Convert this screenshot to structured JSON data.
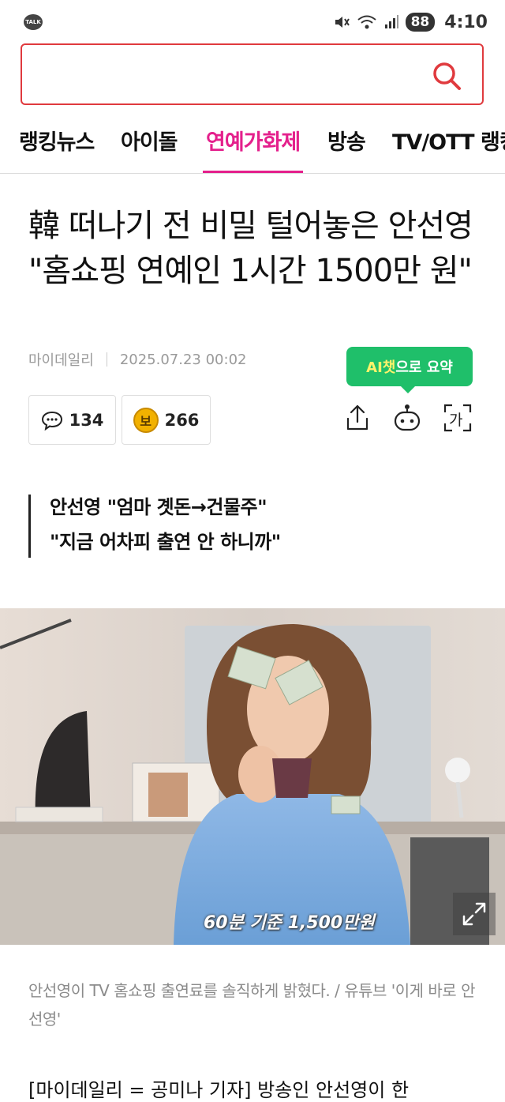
{
  "status_bar": {
    "talk_badge": "TALK",
    "battery": "88",
    "time": "4:10"
  },
  "search": {
    "value": "",
    "placeholder": ""
  },
  "tabs": [
    {
      "label": "랭킹뉴스"
    },
    {
      "label": "아이돌"
    },
    {
      "label": "연예가화제",
      "active": true
    },
    {
      "label": "방송"
    },
    {
      "label": "TV/OTT 랭킹"
    }
  ],
  "article": {
    "headline": "韓 떠나기 전 비밀 털어놓은 안선영 \"홈쇼핑 연예인 1시간 1500만 원\"",
    "source": "마이데일리",
    "datetime": "2025.07.23 00:02",
    "ai_summary": {
      "prefix": "AI챗",
      "suffix": "으로 요약"
    },
    "comment_count": "134",
    "reaction_icon_label": "보",
    "reaction_count": "266",
    "font_icon_label": "가",
    "subheadline": {
      "line1": "안선영 \"엄마 곗돈→건물주\"",
      "line2": "\"지금 어차피 출연 안 하니까\""
    },
    "photo_overlay_text": "60분 기준 1,500만원",
    "photo_caption": "안선영이 TV 홈쇼핑 출연료를 솔직하게 밝혔다. / 유튜브 '이게 바로 안선영'",
    "body_peek": "[마이데일리 = 공미나 기자] 방송인 안선영이 한"
  },
  "colors": {
    "accent": "#e4208c",
    "search_border": "#e03a3e",
    "ai_green": "#1fbf6a"
  }
}
